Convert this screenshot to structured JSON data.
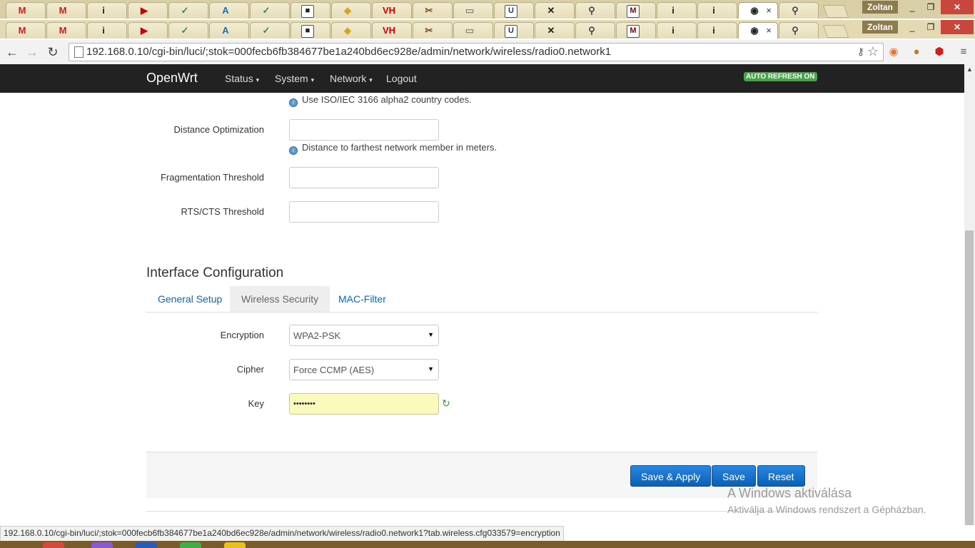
{
  "browser": {
    "tab_icons": [
      "gmail-icon",
      "gmail-icon",
      "info-icon",
      "youtube-icon",
      "v-icon",
      "a-icon",
      "v-icon",
      "router-icon",
      "maps-icon",
      "vh-icon",
      "tool-icon",
      "page-icon",
      "u-icon",
      "tools-icon",
      "search-icon",
      "m-icon",
      "info-icon",
      "info-icon",
      "openwrt-icon",
      "search-icon"
    ],
    "tab_glyphs": [
      "M",
      "M",
      "i",
      "▶",
      "✓",
      "A",
      "✓",
      "■",
      "◈",
      "VH",
      "✂",
      "▭",
      "U",
      "✕",
      "⚲",
      "M",
      "i",
      "i",
      "◉",
      "⚲"
    ],
    "tab_colors": [
      "#c5221f",
      "#c5221f",
      "#222",
      "#cc0000",
      "#2e8b57",
      "#1e6fb8",
      "#2e8b57",
      "#222",
      "#d4a017",
      "#cc0000",
      "#7a4b1e",
      "#888",
      "#1b3a66",
      "#222",
      "#444",
      "#8b0000",
      "#222",
      "#222",
      "#222",
      "#444"
    ],
    "active_tab_close": "×",
    "user_name": "Zoltan",
    "url": "192.168.0.10/cgi-bin/luci/;stok=000fecb6fb384677be1a240bd6ec928e/admin/network/wireless/radio0.network1",
    "status_url": "192.168.0.10/cgi-bin/luci/;stok=000fecb6fb384677be1a240bd6ec928e/admin/network/wireless/radio0.network1?tab.wireless.cfg033579=encryption"
  },
  "nav": {
    "brand": "OpenWrt",
    "menu": [
      "Status",
      "System",
      "Network",
      "Logout"
    ],
    "auto_refresh": "AUTO REFRESH ON"
  },
  "form": {
    "country_hint": "Use ISO/IEC 3166 alpha2 country codes.",
    "distance_label": "Distance Optimization",
    "distance_value": "",
    "distance_hint": "Distance to farthest network member in meters.",
    "frag_label": "Fragmentation Threshold",
    "frag_value": "",
    "rts_label": "RTS/CTS Threshold",
    "rts_value": ""
  },
  "interface": {
    "title": "Interface Configuration",
    "tabs": [
      "General Setup",
      "Wireless Security",
      "MAC-Filter"
    ],
    "active_tab": 1,
    "encryption_label": "Encryption",
    "encryption_value": "WPA2-PSK",
    "cipher_label": "Cipher",
    "cipher_value": "Force CCMP (AES)",
    "key_label": "Key",
    "key_value": "••••••••"
  },
  "actions": {
    "save_apply": "Save & Apply",
    "save": "Save",
    "reset": "Reset"
  },
  "watermark": {
    "title": "A Windows aktiválása",
    "subtitle": "Aktiválja a Windows rendszert a Gépházban."
  }
}
